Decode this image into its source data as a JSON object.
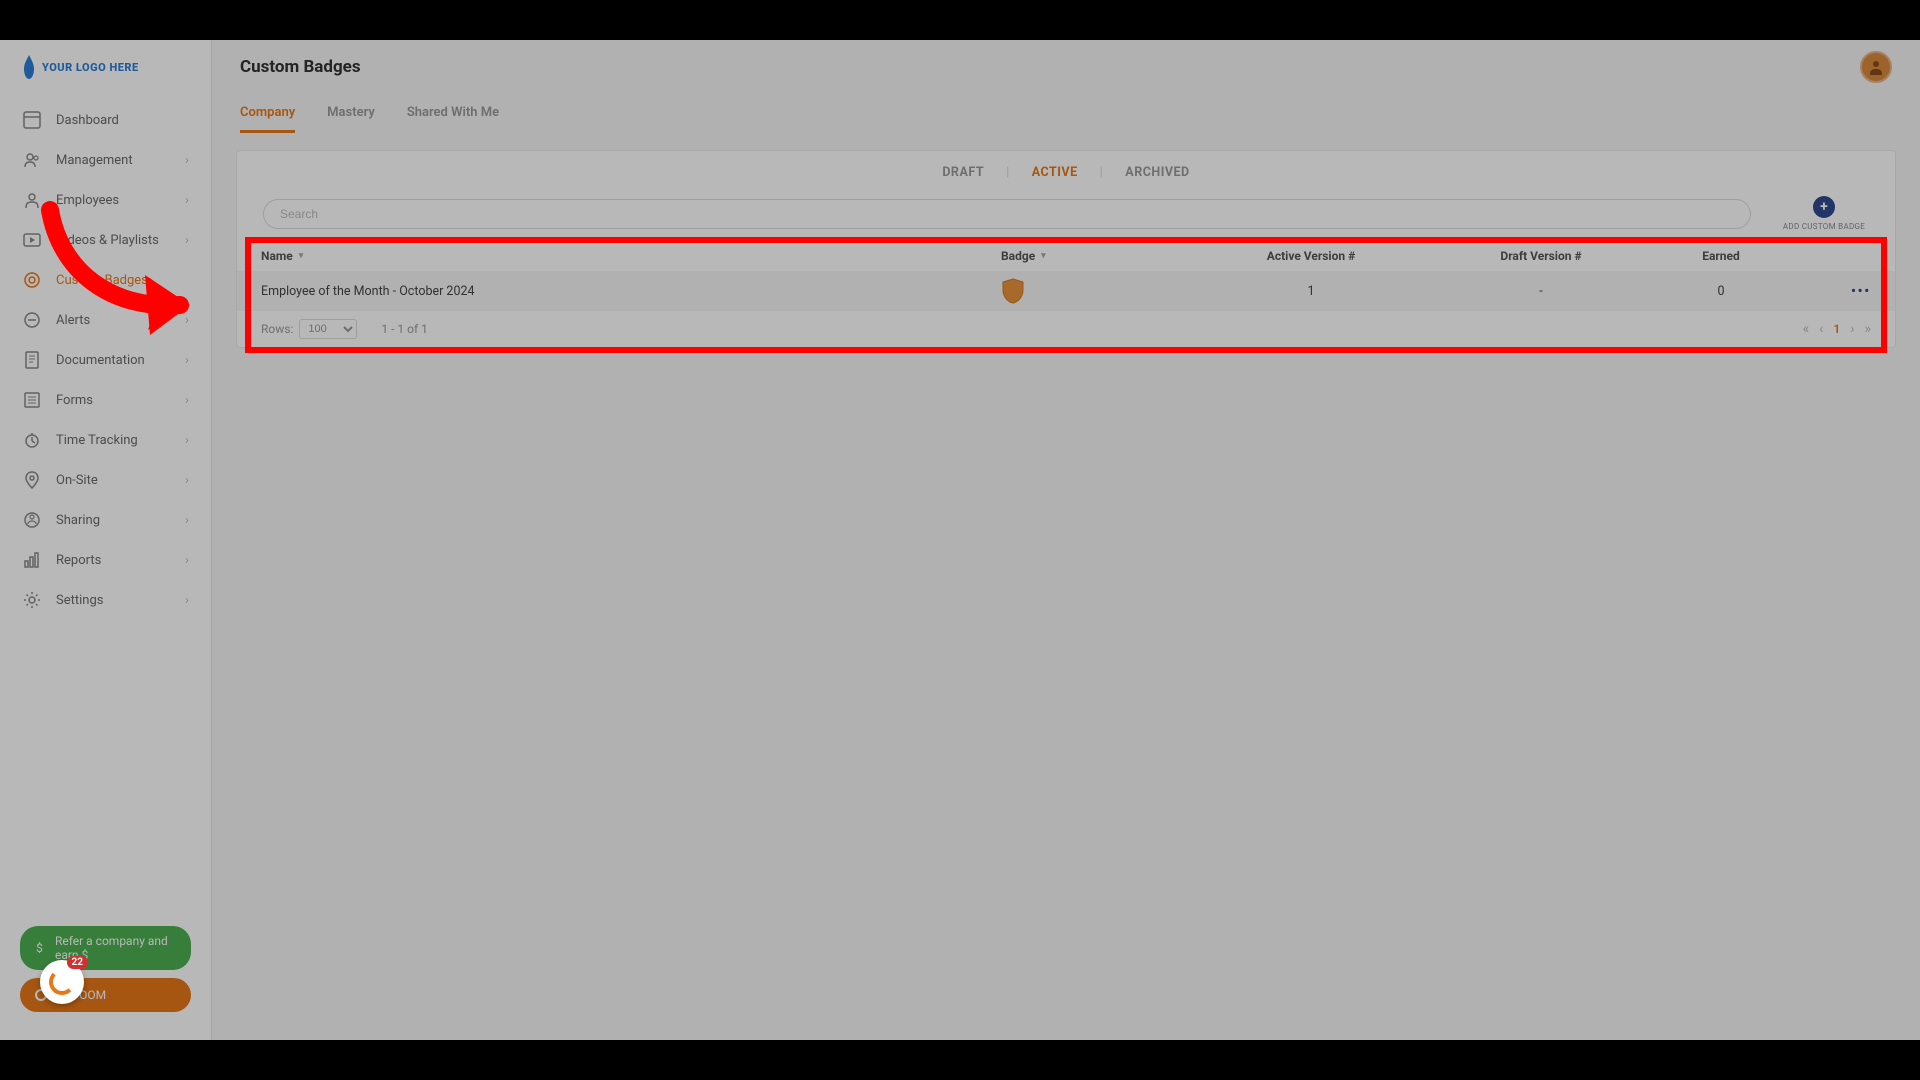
{
  "logo_text": "YOUR LOGO HERE",
  "page_title": "Custom Badges",
  "sidebar": {
    "items": [
      {
        "label": "Dashboard",
        "has_chev": false
      },
      {
        "label": "Management",
        "has_chev": true
      },
      {
        "label": "Employees",
        "has_chev": true
      },
      {
        "label": "Videos & Playlists",
        "has_chev": true
      },
      {
        "label": "Custom Badges",
        "has_chev": false,
        "active": true
      },
      {
        "label": "Alerts",
        "has_chev": true
      },
      {
        "label": "Documentation",
        "has_chev": true
      },
      {
        "label": "Forms",
        "has_chev": true
      },
      {
        "label": "Time Tracking",
        "has_chev": true
      },
      {
        "label": "On-Site",
        "has_chev": true
      },
      {
        "label": "Sharing",
        "has_chev": true
      },
      {
        "label": "Reports",
        "has_chev": true
      },
      {
        "label": "Settings",
        "has_chev": true
      }
    ],
    "refer_label": "Refer a company and earn $",
    "tyfoom_label": "TYFOOM",
    "spinner_count": "22"
  },
  "tabs": [
    {
      "label": "Company",
      "active": true
    },
    {
      "label": "Mastery"
    },
    {
      "label": "Shared With Me"
    }
  ],
  "status_filters": [
    {
      "label": "DRAFT"
    },
    {
      "label": "ACTIVE",
      "active": true
    },
    {
      "label": "ARCHIVED"
    }
  ],
  "search_placeholder": "Search",
  "add_button_label": "ADD CUSTOM BADGE",
  "table": {
    "columns": {
      "name": "Name",
      "badge": "Badge",
      "active_version": "Active Version #",
      "draft_version": "Draft Version #",
      "earned": "Earned"
    },
    "rows": [
      {
        "name": "Employee of the Month - October 2024",
        "active_version": "1",
        "draft_version": "-",
        "earned": "0"
      }
    ]
  },
  "pager": {
    "rows_label": "Rows:",
    "rows_value": "100",
    "range_text": "1 - 1 of 1",
    "current_page": "1"
  },
  "colors": {
    "accent": "#e77817",
    "highlight": "#ff0000",
    "primary_dark": "#2f4b8f"
  }
}
